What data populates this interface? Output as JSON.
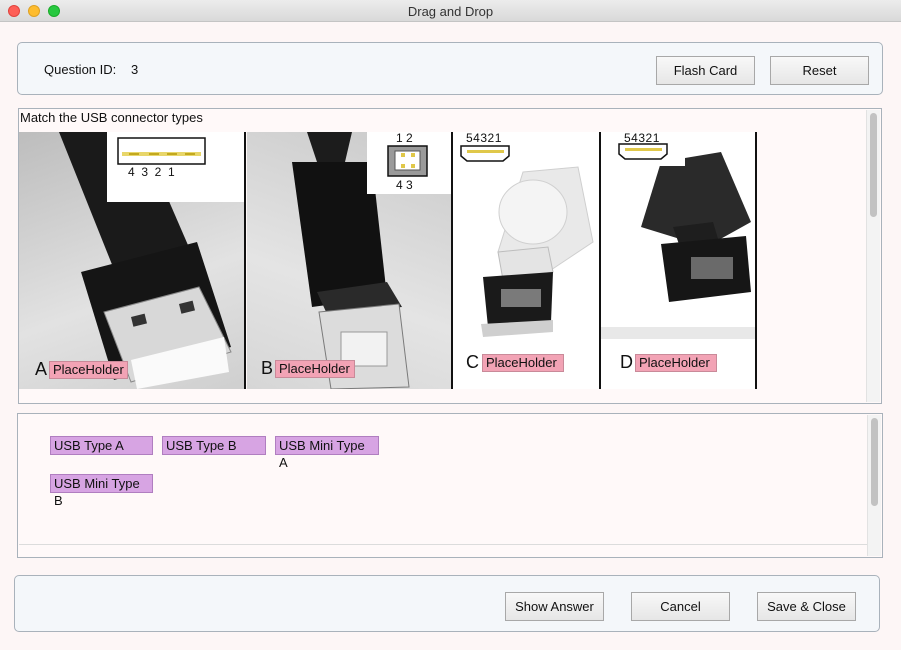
{
  "window": {
    "title": "Drag and Drop"
  },
  "header": {
    "question_id_label": "Question ID:",
    "question_id_value": "3",
    "flash_card_label": "Flash Card",
    "reset_label": "Reset"
  },
  "question": {
    "instruction": "Match the USB connector types",
    "connectors": [
      {
        "letter": "A",
        "placeholder": "PlaceHolder",
        "pins": "4  3  2  1"
      },
      {
        "letter": "B",
        "placeholder": "PlaceHolder",
        "pins_top": "1 2",
        "pins_bottom": "4 3"
      },
      {
        "letter": "C",
        "placeholder": "PlaceHolder",
        "pins": "54321"
      },
      {
        "letter": "D",
        "placeholder": "PlaceHolder",
        "pins": "54321"
      }
    ]
  },
  "answers": [
    {
      "label": "USB Type A"
    },
    {
      "label": "USB Type B"
    },
    {
      "label": "USB Mini Type A"
    },
    {
      "label": "USB Mini Type B"
    }
  ],
  "footer": {
    "show_answer_label": "Show Answer",
    "cancel_label": "Cancel",
    "save_close_label": "Save & Close"
  },
  "colors": {
    "placeholder_bg": "#f2a3b5",
    "answer_chip_bg": "#d7a4e3",
    "panel_bg": "#f4f7fa"
  }
}
